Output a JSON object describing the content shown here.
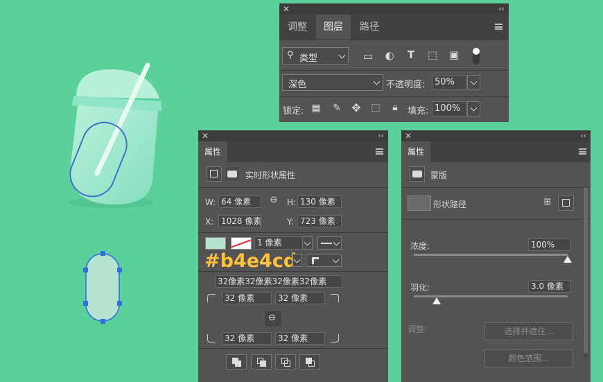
{
  "colors": {
    "background": "#5cd09b",
    "fill_swatch": "#b4e4cd",
    "panel": "#535353",
    "accent_annotation": "#ffc13b"
  },
  "layers_panel": {
    "tabs": [
      {
        "label": "调整"
      },
      {
        "label": "图层"
      },
      {
        "label": "路径"
      }
    ],
    "active_tab": "图层",
    "filter_select": "类型",
    "blend_mode": "深色",
    "opacity_label": "不透明度:",
    "opacity_value": "50%",
    "lock_label": "锁定:",
    "fill_label": "填充:",
    "fill_value": "100%"
  },
  "properties_panel": {
    "tab": "属性",
    "header": "实时形状属性",
    "w_label": "W:",
    "w_value": "64 像素",
    "h_label": "H:",
    "h_value": "130 像素",
    "x_label": "X:",
    "x_value": "1028 像素",
    "y_label": "Y:",
    "y_value": "723 像素",
    "stroke_width": "1 像素",
    "corner_all": "32像素32像素32像素32像素",
    "corner_tl": "32 像素",
    "corner_tr": "32 像素",
    "corner_bl": "32 像素",
    "corner_br": "32 像素",
    "color_annotation": "#b4e4cd"
  },
  "mask_panel": {
    "tab": "属性",
    "header": "蒙版",
    "shape_path": "形状路径",
    "density_label": "浓度:",
    "density_value": "100%",
    "density_level": 1.0,
    "feather_label": "羽化:",
    "feather_value": "3.0 像素",
    "feather_level": 0.15,
    "adjust_label": "调整:",
    "select_mask_btn": "选择并遮住...",
    "color_range_btn": "颜色范围..."
  }
}
